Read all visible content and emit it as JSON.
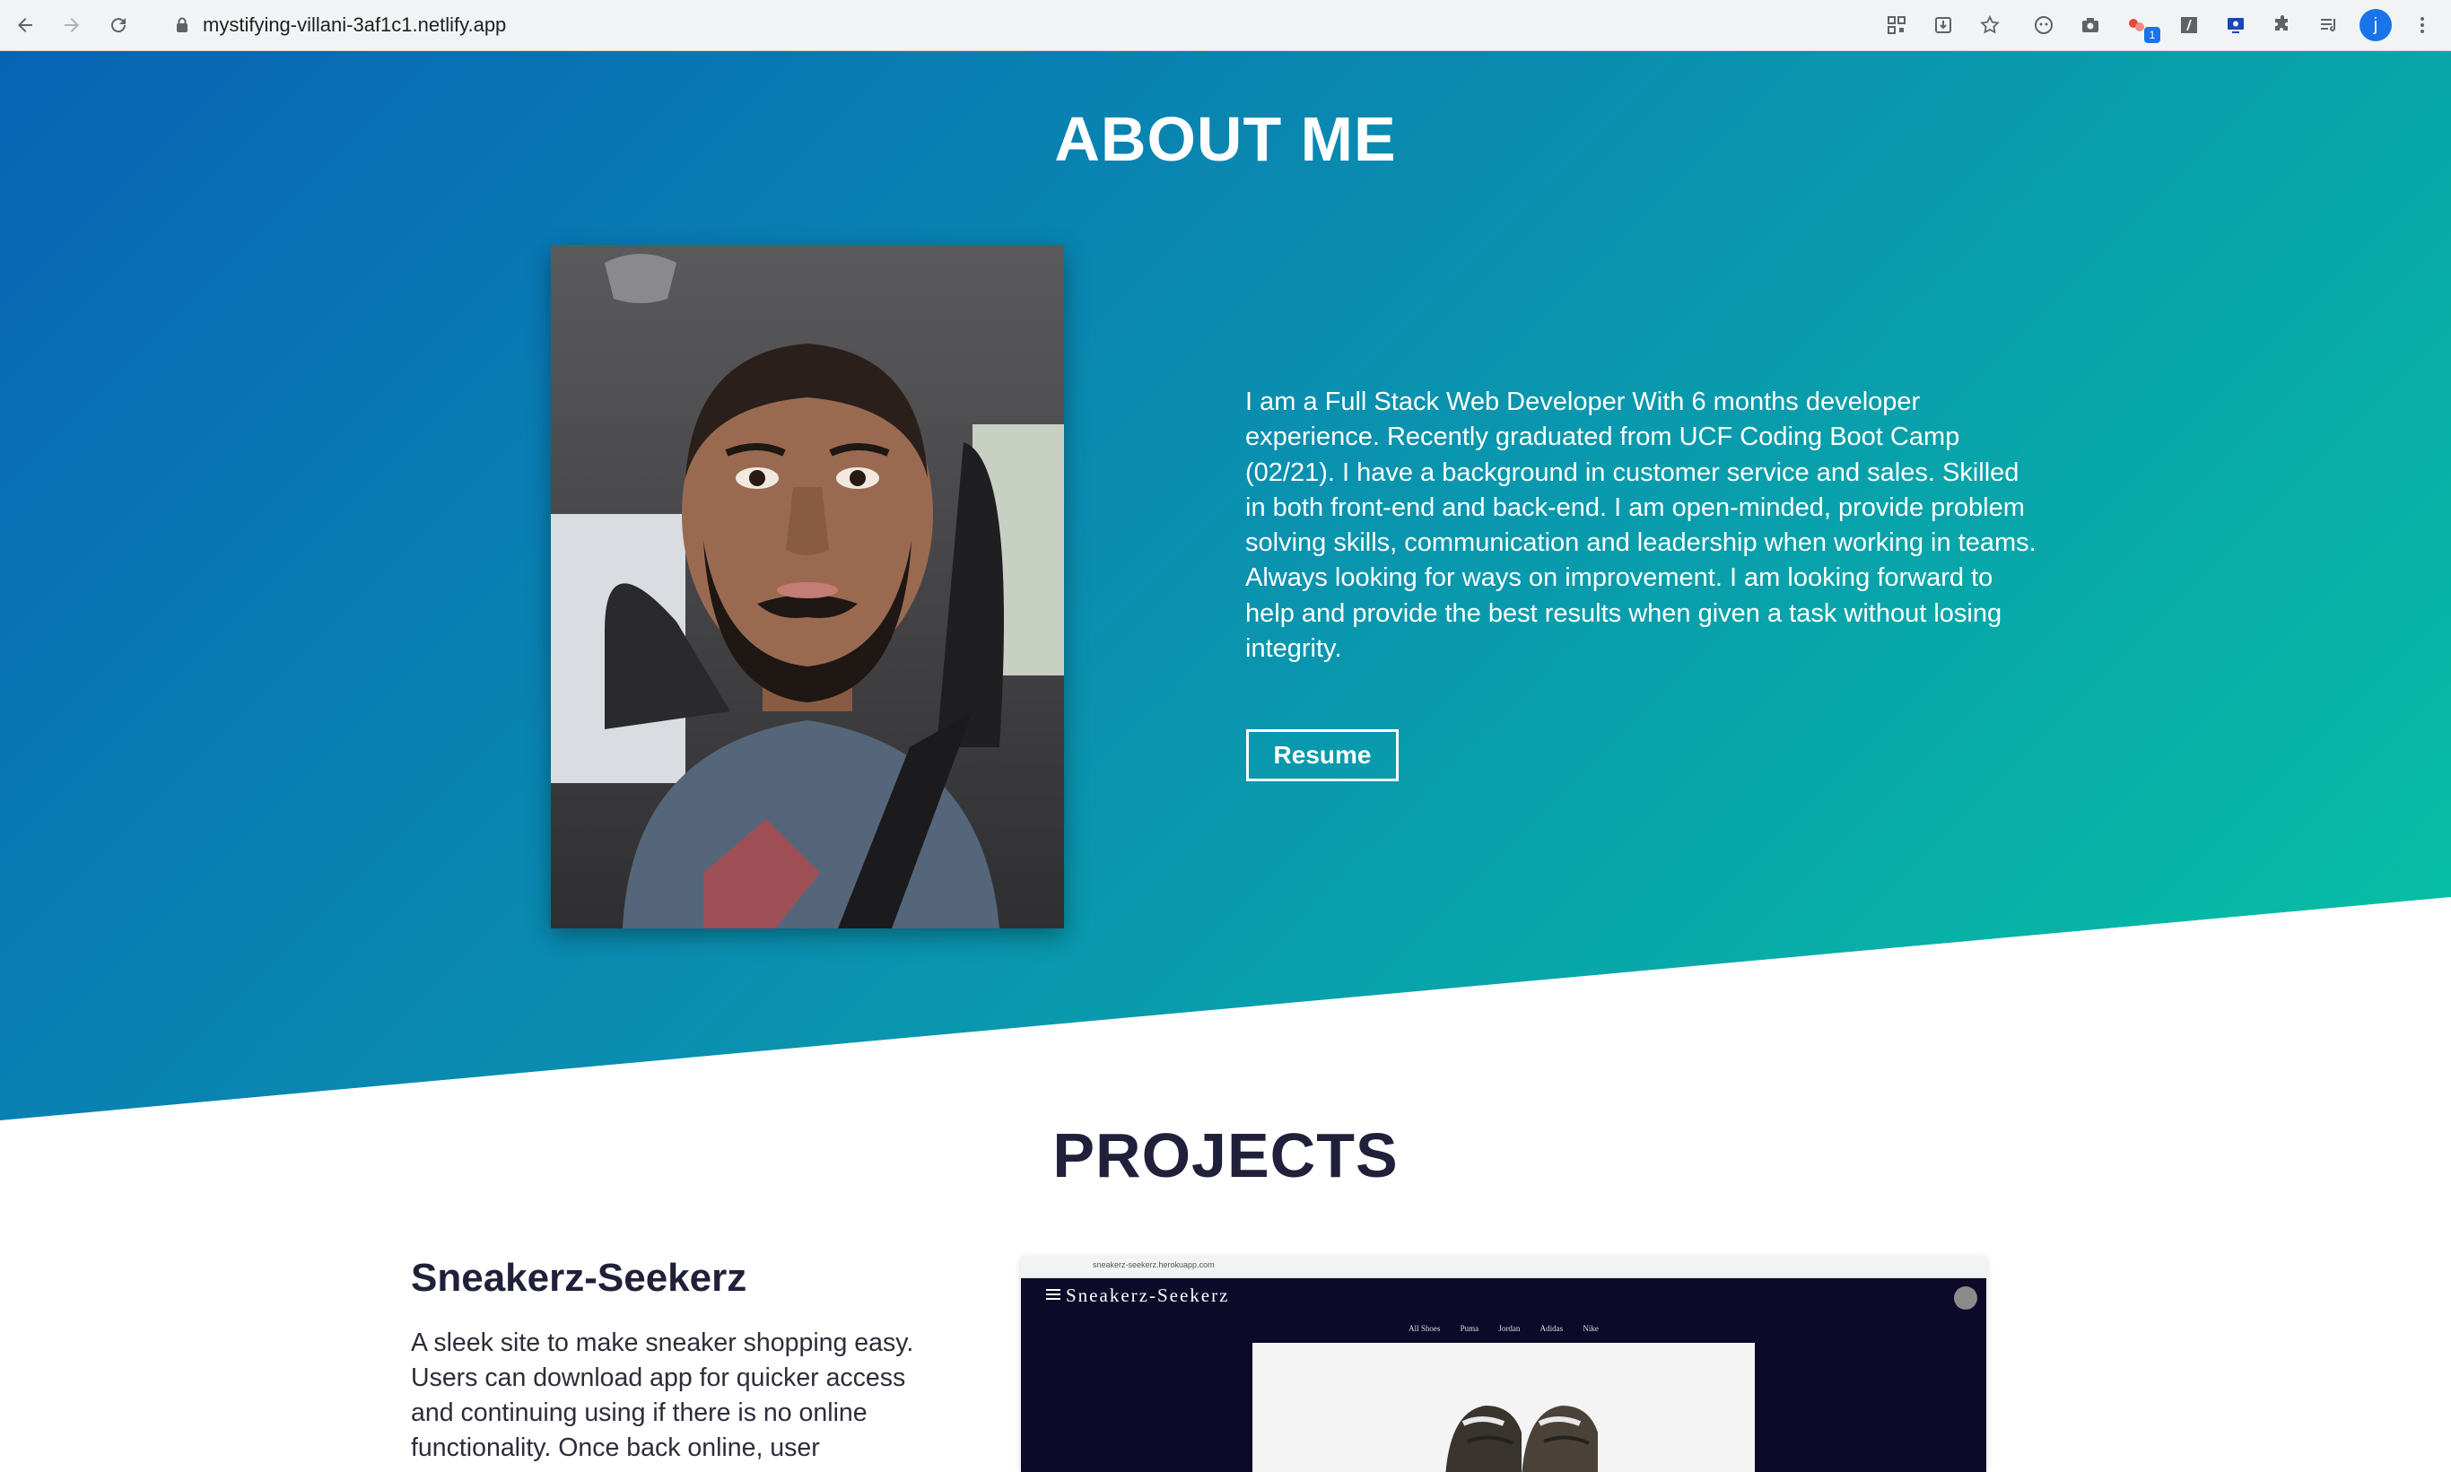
{
  "browser": {
    "url": "mystifying-villani-3af1c1.netlify.app",
    "extension_badge": "1",
    "profile_initial": "j"
  },
  "about": {
    "title": "ABOUT ME",
    "bio": "I am a Full Stack Web Developer With 6 months developer experience. Recently graduated from UCF Coding Boot Camp (02/21). I have a background in customer service and sales. Skilled in both front-end and back-end. I am open-minded, provide problem solving skills, communication and leadership when working in teams. Always looking for ways on improvement. I am looking forward to help and provide the best results when given a task without losing integrity.",
    "resume_label": "Resume",
    "photo_icon": "profile-photo"
  },
  "projects": {
    "title": "PROJECTS",
    "items": [
      {
        "name": "Sneakerz-Seekerz",
        "description": "A sleek site to make sneaker shopping easy. Users can download app for quicker access and continuing using if there is no online functionality. Once back online, user",
        "screenshot": {
          "url": "sneakerz-seekerz.herokuapp.com",
          "brand": "Sneakerz-Seekerz",
          "nav": [
            "All Shoes",
            "Puma",
            "Jordan",
            "Adidas",
            "Nike"
          ]
        }
      }
    ]
  },
  "colors": {
    "gradient_start": "#0764b5",
    "gradient_end": "#06c4a3",
    "heading_dark": "#20203a"
  }
}
